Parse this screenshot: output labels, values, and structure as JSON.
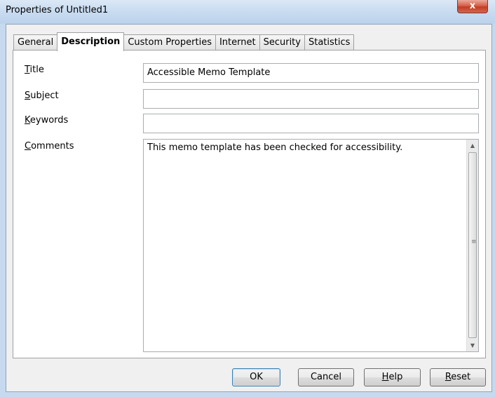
{
  "window": {
    "title": "Properties of Untitled1",
    "close_label": "x"
  },
  "tabs": [
    {
      "label": "General",
      "active": false
    },
    {
      "label": "Description",
      "active": true
    },
    {
      "label": "Custom Properties",
      "active": false
    },
    {
      "label": "Internet",
      "active": false
    },
    {
      "label": "Security",
      "active": false
    },
    {
      "label": "Statistics",
      "active": false
    }
  ],
  "fields": {
    "title": {
      "label_mnemonic": "T",
      "label_rest": "itle",
      "value": "Accessible Memo Template"
    },
    "subject": {
      "label_mnemonic": "S",
      "label_rest": "ubject",
      "value": ""
    },
    "keywords": {
      "label_mnemonic": "K",
      "label_rest": "eywords",
      "value": ""
    },
    "comments": {
      "label_mnemonic": "C",
      "label_rest": "omments",
      "value": "This memo template has been checked for accessibility."
    }
  },
  "buttons": {
    "ok": "OK",
    "cancel": "Cancel",
    "help_mnemonic": "H",
    "help_rest": "elp",
    "reset_mnemonic": "R",
    "reset_rest": "eset"
  },
  "scrollbar": {
    "up_glyph": "▲",
    "down_glyph": "▼",
    "grip_glyph": "≡"
  }
}
